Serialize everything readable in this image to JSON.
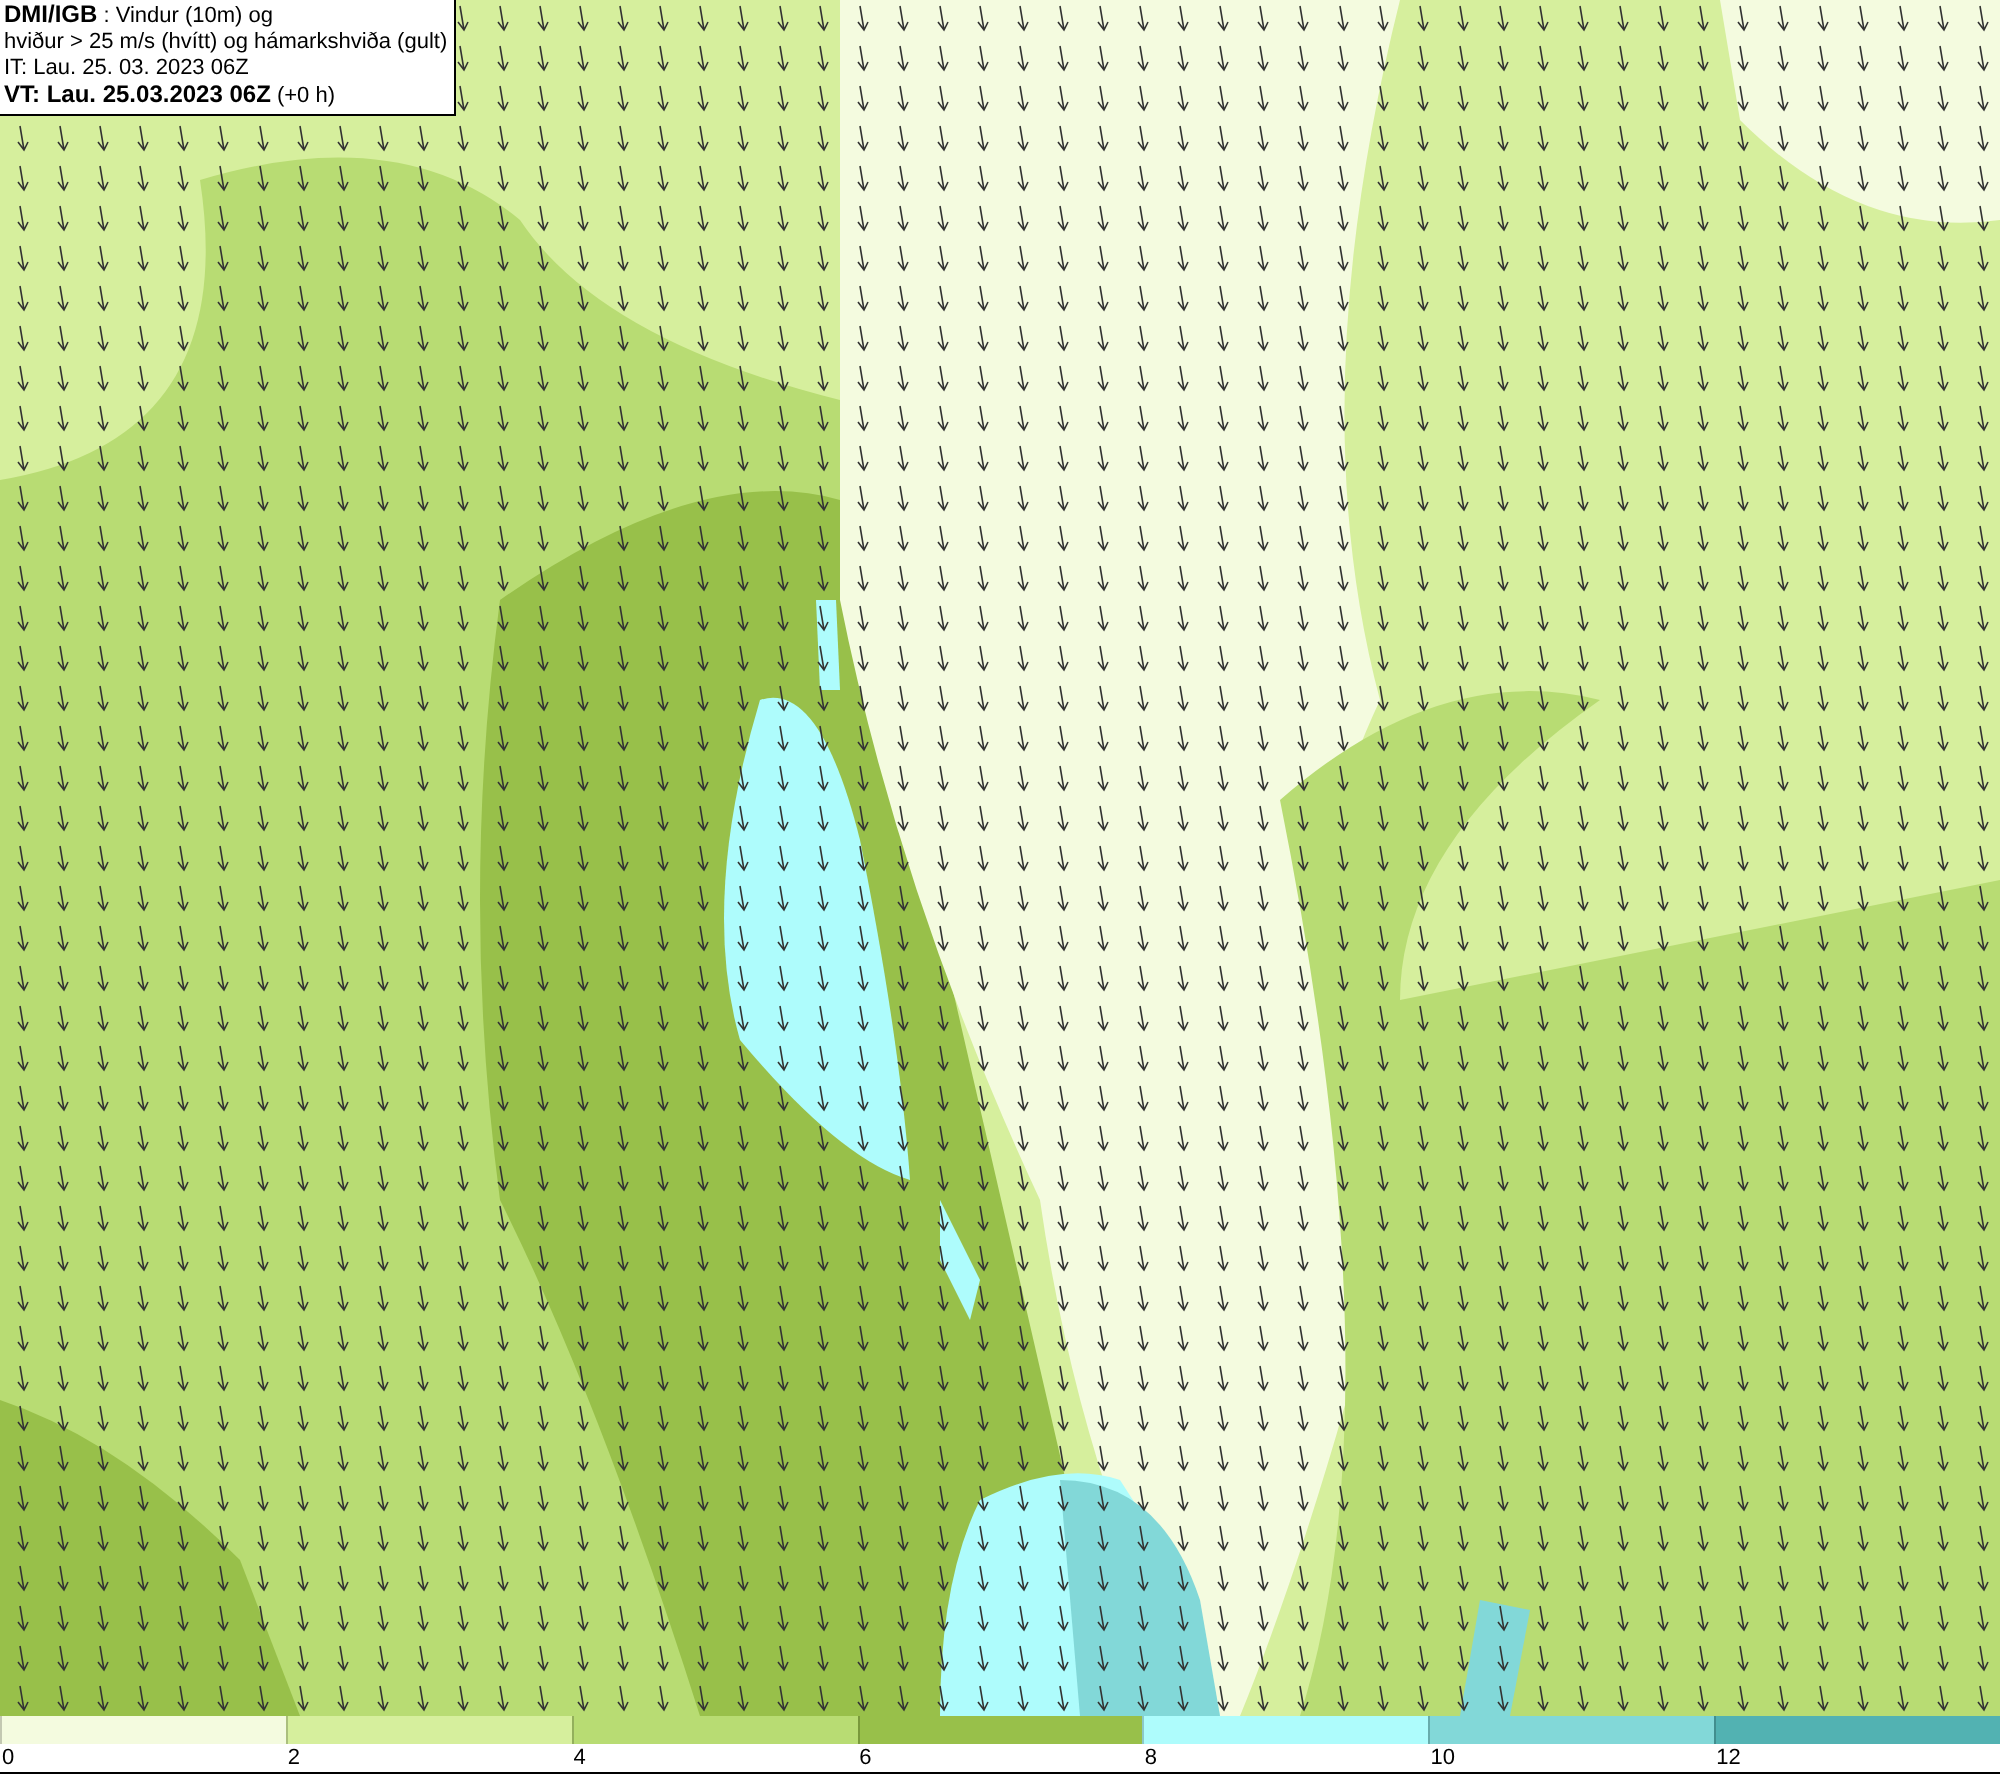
{
  "info_box": {
    "lines": [
      "**DMI/IGB** : Vindur (10m) og",
      "hviður > 25 m/s (hvítt) og hámarkshviða (gult)",
      "IT: Lau. 25. 03. 2023 06Z",
      "**VT: Lau. 25.03.2023 06Z** (+0 h)"
    ]
  },
  "legend": {
    "bins": [
      {
        "label": "0",
        "color": "#f4fbdf"
      },
      {
        "label": "2",
        "color": "#d6ef9d"
      },
      {
        "label": "4",
        "color": "#b8dc73"
      },
      {
        "label": "6",
        "color": "#98c04a"
      },
      {
        "label": "8",
        "color": "#aefcfc"
      },
      {
        "label": "10",
        "color": "#82d8d8"
      },
      {
        "label": "12",
        "color": "#52b2b2"
      }
    ]
  }
}
